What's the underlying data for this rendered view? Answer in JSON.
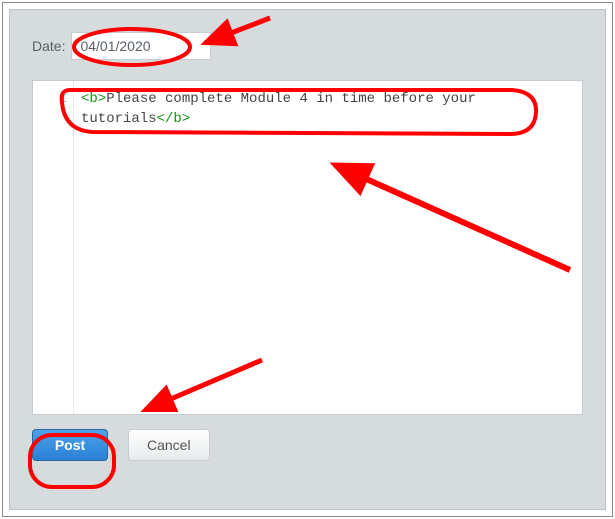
{
  "date": {
    "label": "Date:",
    "value": "04/01/2020"
  },
  "editor": {
    "line_number": "1",
    "open_tag": "<b>",
    "text": "Please complete Module 4 in time before your tutorials",
    "close_tag": "</b>"
  },
  "buttons": {
    "post": "Post",
    "cancel": "Cancel"
  }
}
